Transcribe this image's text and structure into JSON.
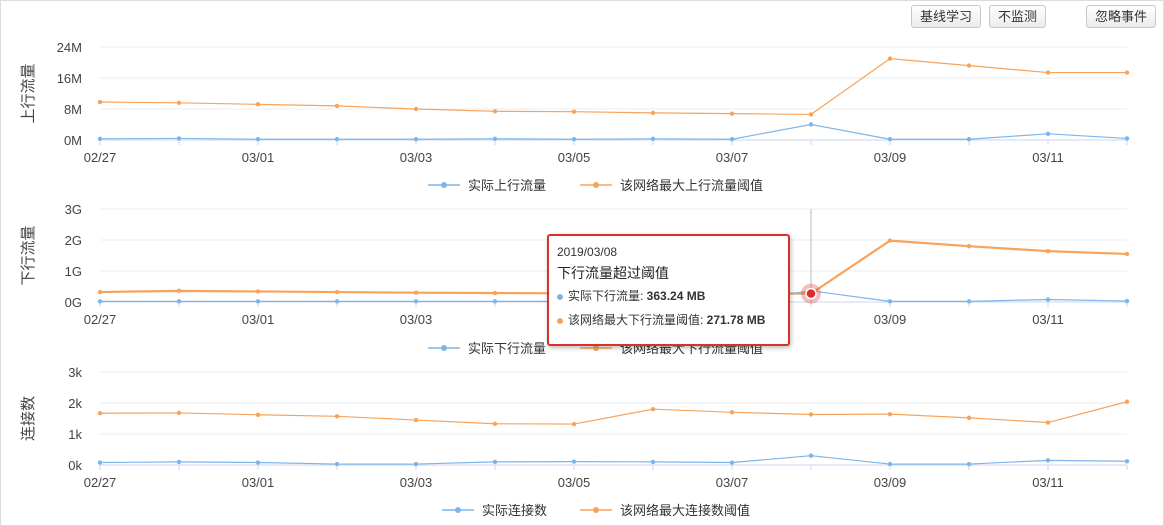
{
  "toolbar": {
    "baseline_label": "基线学习",
    "no_monitor_label": "不监测",
    "ignore_label": "忽略事件"
  },
  "colors": {
    "actual": "#7cb5ec",
    "threshold": "#f7a35c",
    "alert": "#d9302c"
  },
  "tooltip": {
    "date": "2019/03/08",
    "title": "下行流量超过阈值",
    "rows": [
      {
        "label": "实际下行流量: ",
        "value": "363.24 MB"
      },
      {
        "label": "该网络最大下行流量阈值: ",
        "value": "271.78 MB"
      }
    ]
  },
  "chart_data": [
    {
      "type": "line",
      "ylabel": "上行流量",
      "categories": [
        "02/27",
        "02/28",
        "03/01",
        "03/02",
        "03/03",
        "03/04",
        "03/05",
        "03/06",
        "03/07",
        "03/08",
        "03/09",
        "03/10",
        "03/11",
        "03/12"
      ],
      "x_tick_labels": [
        "02/27",
        "03/01",
        "03/03",
        "03/05",
        "03/07",
        "03/09",
        "03/11"
      ],
      "y_ticks": [
        "0M",
        "8M",
        "16M",
        "24M"
      ],
      "ylim": [
        0,
        24
      ],
      "y_unit": "M",
      "grid": true,
      "legend": "bottom-center",
      "series": [
        {
          "name": "实际上行流量",
          "values": [
            0.3,
            0.4,
            0.2,
            0.2,
            0.2,
            0.3,
            0.2,
            0.3,
            0.2,
            4.0,
            0.2,
            0.2,
            1.6,
            0.4
          ]
        },
        {
          "name": "该网络最大上行流量阈值",
          "values": [
            9.8,
            9.6,
            9.2,
            8.8,
            8.0,
            7.4,
            7.3,
            7.0,
            6.8,
            6.6,
            21.0,
            19.2,
            17.4,
            17.4
          ]
        }
      ]
    },
    {
      "type": "line",
      "ylabel": "下行流量",
      "categories": [
        "02/27",
        "02/28",
        "03/01",
        "03/02",
        "03/03",
        "03/04",
        "03/05",
        "03/06",
        "03/07",
        "03/08",
        "03/09",
        "03/10",
        "03/11",
        "03/12"
      ],
      "x_tick_labels": [
        "02/27",
        "03/01",
        "03/03",
        "03/05",
        "03/07",
        "03/09",
        "03/11"
      ],
      "y_ticks": [
        "0G",
        "1G",
        "2G",
        "3G"
      ],
      "ylim": [
        0,
        3
      ],
      "y_unit": "G",
      "grid": true,
      "legend": "bottom-center",
      "highlight_index": 9,
      "series": [
        {
          "name": "实际下行流量",
          "values": [
            0.02,
            0.02,
            0.02,
            0.02,
            0.02,
            0.02,
            0.02,
            0.02,
            0.02,
            0.36,
            0.02,
            0.02,
            0.08,
            0.03
          ]
        },
        {
          "name": "该网络最大下行流量阈值",
          "values": [
            0.32,
            0.36,
            0.34,
            0.32,
            0.3,
            0.29,
            0.28,
            0.28,
            0.28,
            0.27,
            1.98,
            1.8,
            1.64,
            1.55
          ]
        }
      ]
    },
    {
      "type": "line",
      "ylabel": "连接数",
      "categories": [
        "02/27",
        "02/28",
        "03/01",
        "03/02",
        "03/03",
        "03/04",
        "03/05",
        "03/06",
        "03/07",
        "03/08",
        "03/09",
        "03/10",
        "03/11",
        "03/12"
      ],
      "x_tick_labels": [
        "02/27",
        "03/01",
        "03/03",
        "03/05",
        "03/07",
        "03/09",
        "03/11"
      ],
      "y_ticks": [
        "0k",
        "1k",
        "2k",
        "3k"
      ],
      "ylim": [
        0,
        3
      ],
      "y_unit": "k",
      "grid": true,
      "legend": "bottom-center",
      "series": [
        {
          "name": "实际连接数",
          "values": [
            0.08,
            0.1,
            0.08,
            0.03,
            0.03,
            0.1,
            0.11,
            0.1,
            0.08,
            0.3,
            0.03,
            0.03,
            0.15,
            0.12
          ]
        },
        {
          "name": "该网络最大连接数阈值",
          "values": [
            1.67,
            1.68,
            1.62,
            1.57,
            1.45,
            1.33,
            1.32,
            1.8,
            1.7,
            1.63,
            1.64,
            1.52,
            1.37,
            2.04
          ]
        }
      ]
    }
  ]
}
